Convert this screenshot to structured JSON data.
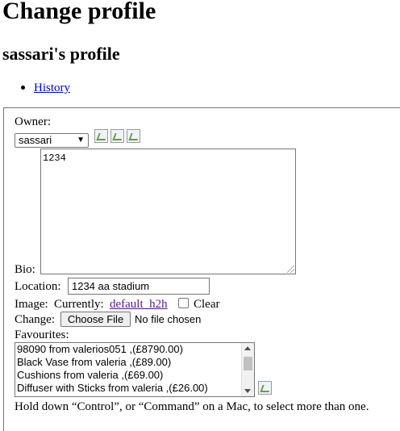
{
  "page": {
    "title": "Change profile",
    "subtitle": "sassari's profile",
    "nav": {
      "history_link": "History"
    }
  },
  "form": {
    "owner": {
      "label": "Owner:",
      "selected": "sassari",
      "action_icons": [
        "edit-icon",
        "add-icon",
        "view-icon"
      ]
    },
    "bio": {
      "label": "Bio:",
      "value": "1234"
    },
    "location": {
      "label": "Location:",
      "value": "1234 aa stadium"
    },
    "image": {
      "label": "Image:",
      "currently_label": "Currently:",
      "current_file": "default_h2h",
      "clear_label": "Clear",
      "clear_checked": false,
      "change_label": "Change:",
      "choose_button": "Choose File",
      "file_status": "No file chosen"
    },
    "favourites": {
      "label": "Favourites:",
      "options": [
        "98090 from valerios051 ,(£8790.00)",
        "Black Vase from valeria ,(£89.00)",
        "Cushions from valeria ,(£69.00)",
        "Diffuser with Sticks from valeria ,(£26.00)"
      ],
      "add_icon": "add-icon",
      "help_text": "Hold down “Control”, or “Command” on a Mac, to select more than one."
    }
  }
}
